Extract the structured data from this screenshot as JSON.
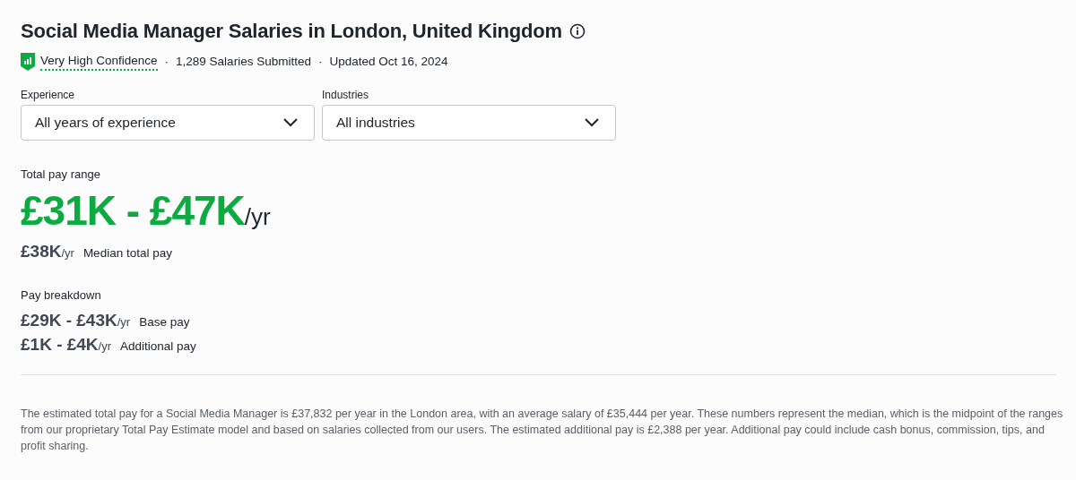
{
  "title": "Social Media Manager Salaries in London, United Kingdom",
  "meta": [
    {
      "kind": "confidence",
      "text": "Very High Confidence"
    },
    {
      "kind": "separator",
      "text": "·"
    },
    {
      "kind": "plain",
      "text": "1,289 Salaries Submitted"
    },
    {
      "kind": "separator",
      "text": "·"
    },
    {
      "kind": "plain",
      "text": "Updated Oct 16, 2024"
    }
  ],
  "filters": [
    {
      "label": "Experience",
      "value": "All years of experience"
    },
    {
      "label": "Industries",
      "value": "All industries"
    }
  ],
  "total": {
    "label": "Total pay range",
    "range": "£31K - £47K",
    "unit": "/yr"
  },
  "median": {
    "amount": "£38K",
    "unit": "/yr",
    "label": "Median total pay"
  },
  "breakdown": {
    "label": "Pay breakdown",
    "items": [
      {
        "amount": "£29K - £43K",
        "unit": "/yr",
        "label": "Base pay"
      },
      {
        "amount": "£1K - £4K",
        "unit": "/yr",
        "label": "Additional pay"
      }
    ]
  },
  "description": "The estimated total pay for a Social Media Manager is £37,832 per year in the London area, with an average salary of £35,444 per year. These numbers represent the median, which is the midpoint of the ranges from our proprietary Total Pay Estimate model and based on salaries collected from our users. The estimated additional pay is £2,388 per year. Additional pay could include cash bonus, commission, tips, and profit sharing."
}
